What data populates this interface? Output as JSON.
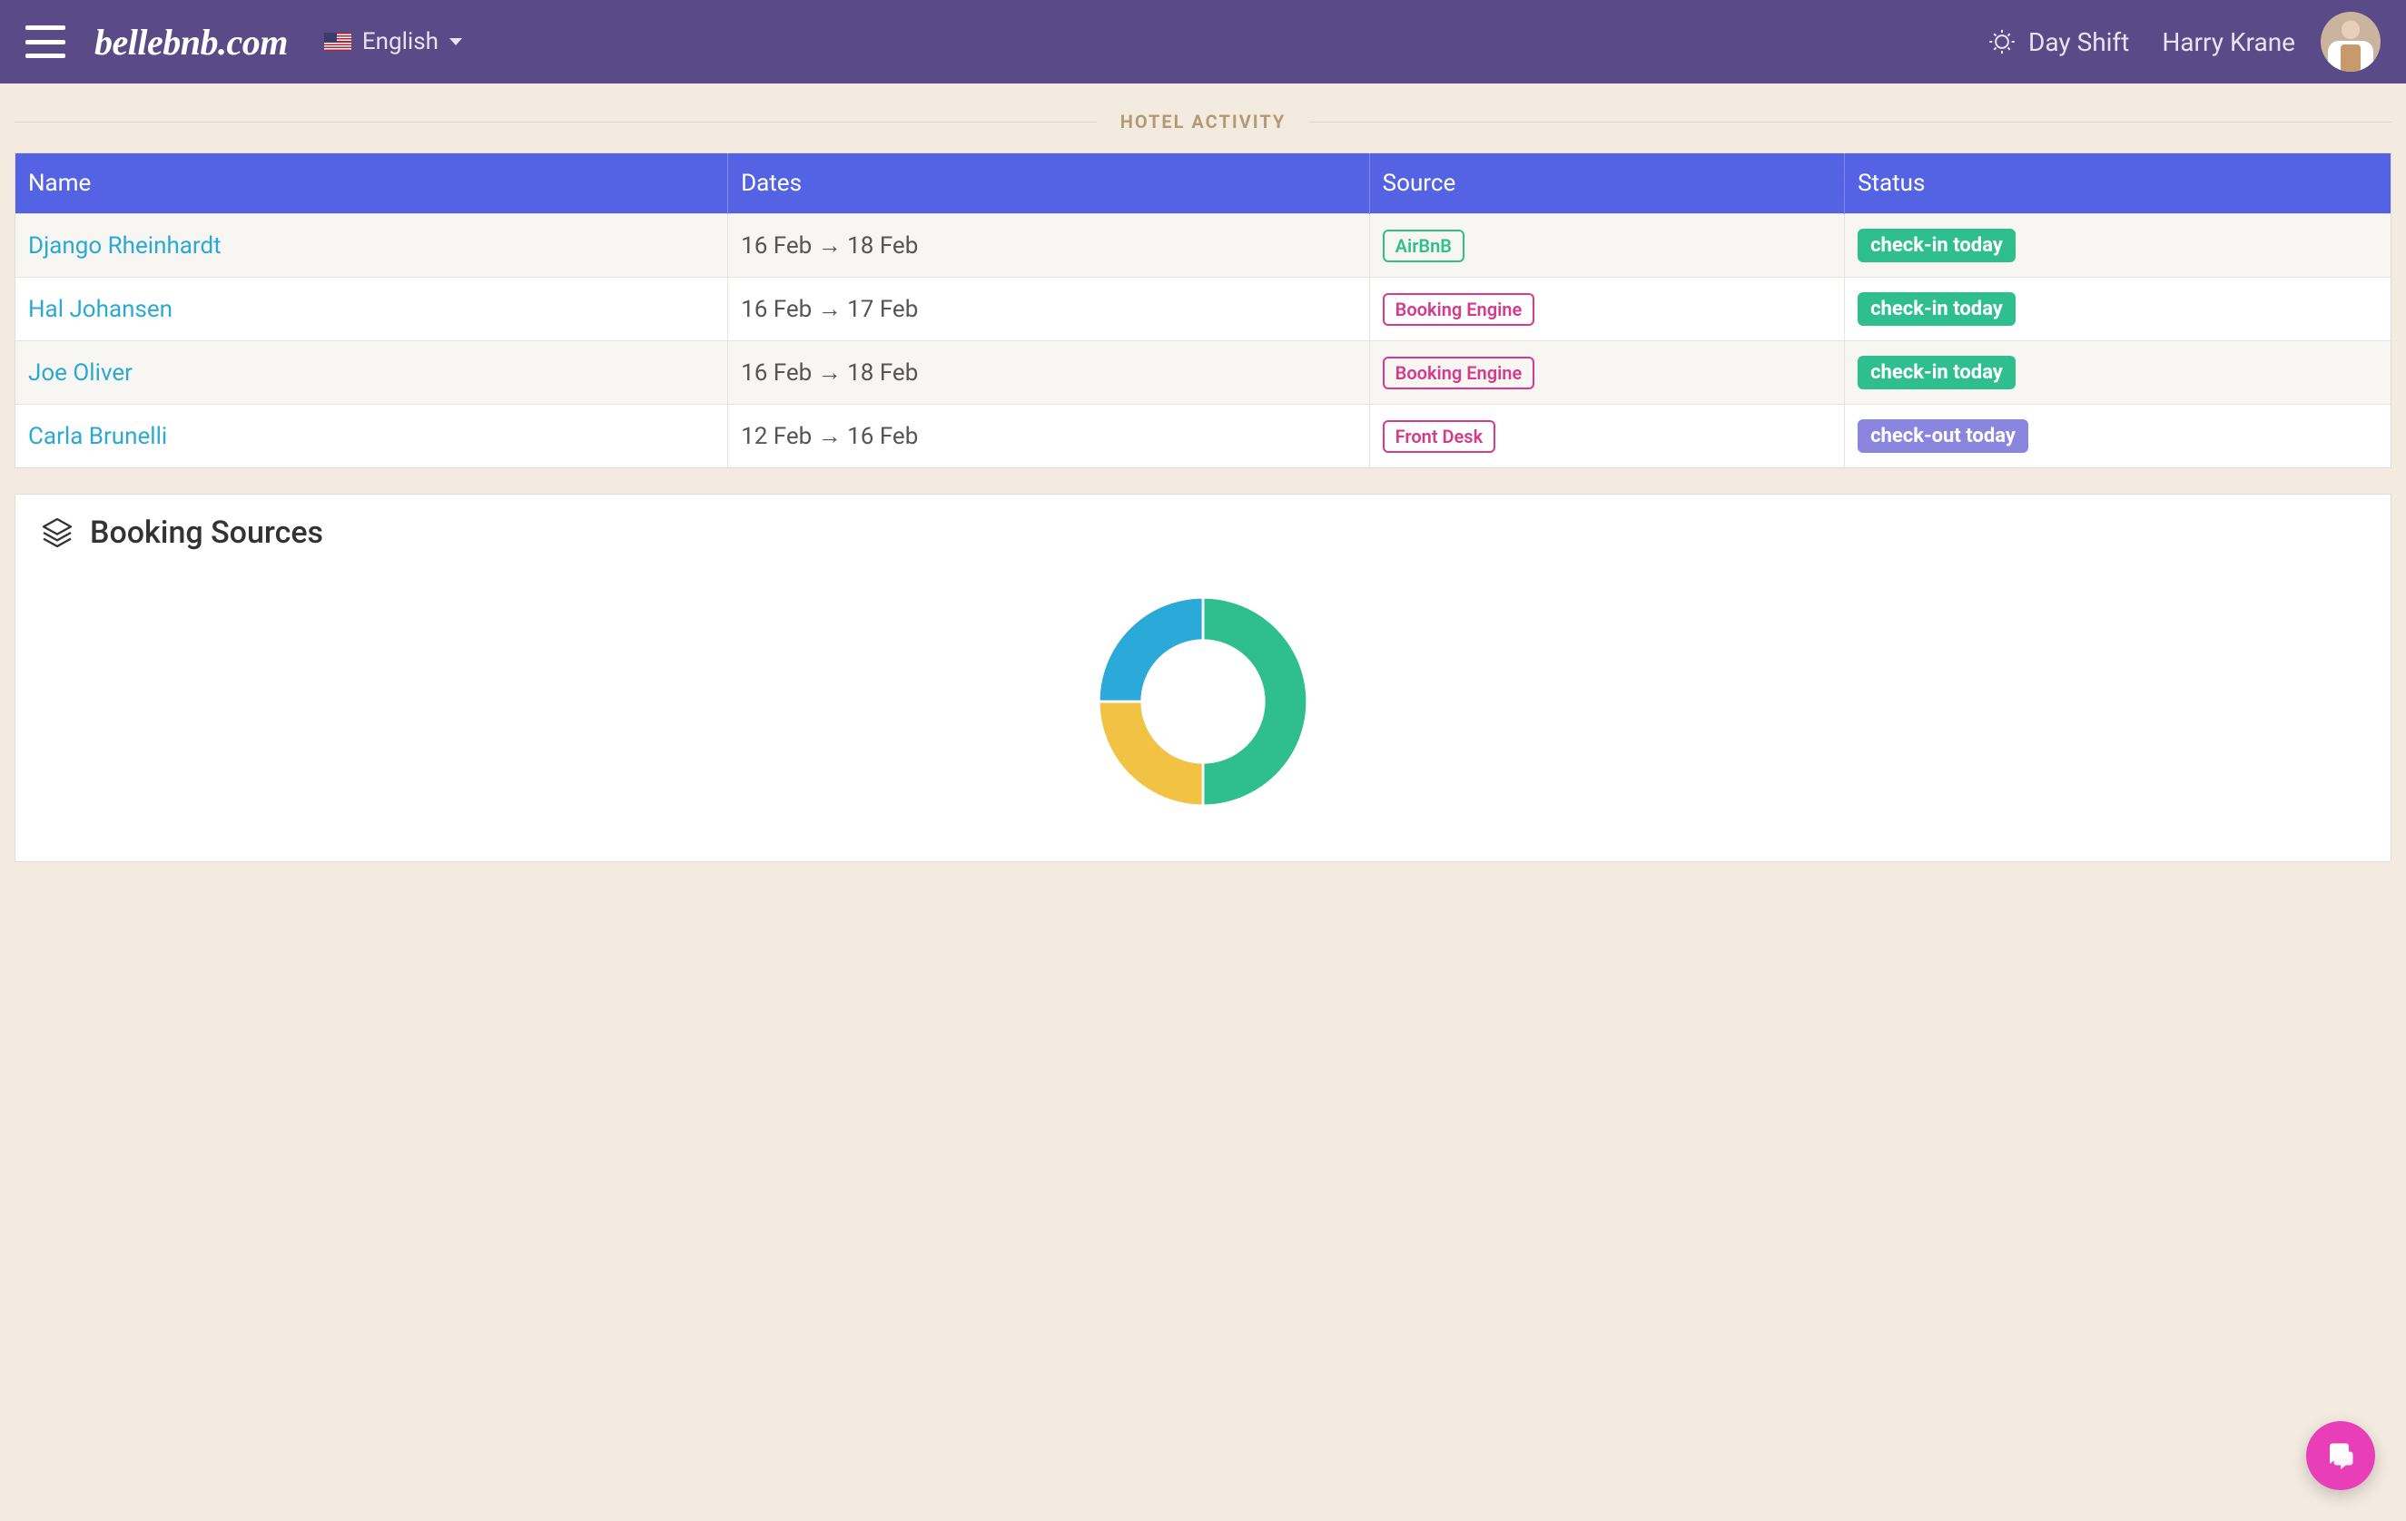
{
  "header": {
    "brand": "bellebnb.com",
    "language": "English",
    "shift_label": "Day Shift",
    "user_name": "Harry Krane"
  },
  "section_title": "HOTEL ACTIVITY",
  "table": {
    "columns": [
      "Name",
      "Dates",
      "Source",
      "Status"
    ],
    "rows": [
      {
        "name": "Django Rheinhardt",
        "dates": "16 Feb → 18 Feb",
        "source": {
          "label": "AirBnB",
          "color": "#2fbf8f"
        },
        "status": {
          "label": "check-in today",
          "bg": "#2fbf8f"
        }
      },
      {
        "name": "Hal Johansen",
        "dates": "16 Feb → 17 Feb",
        "source": {
          "label": "Booking Engine",
          "color": "#d63a8b"
        },
        "status": {
          "label": "check-in today",
          "bg": "#2fbf8f"
        }
      },
      {
        "name": "Joe Oliver",
        "dates": "16 Feb → 18 Feb",
        "source": {
          "label": "Booking Engine",
          "color": "#d63a8b"
        },
        "status": {
          "label": "check-in today",
          "bg": "#2fbf8f"
        }
      },
      {
        "name": "Carla Brunelli",
        "dates": "12 Feb → 16 Feb",
        "source": {
          "label": "Front Desk",
          "color": "#d63a8b"
        },
        "status": {
          "label": "check-out today",
          "bg": "#8a86e0"
        }
      }
    ]
  },
  "booking_sources_title": "Booking Sources",
  "chart_data": {
    "type": "pie",
    "title": "Booking Sources",
    "series": [
      {
        "name": "Green",
        "value": 50,
        "color": "#2fbf8f"
      },
      {
        "name": "Yellow",
        "value": 25,
        "color": "#f2c244"
      },
      {
        "name": "Blue",
        "value": 25,
        "color": "#2ba9d9"
      }
    ]
  }
}
